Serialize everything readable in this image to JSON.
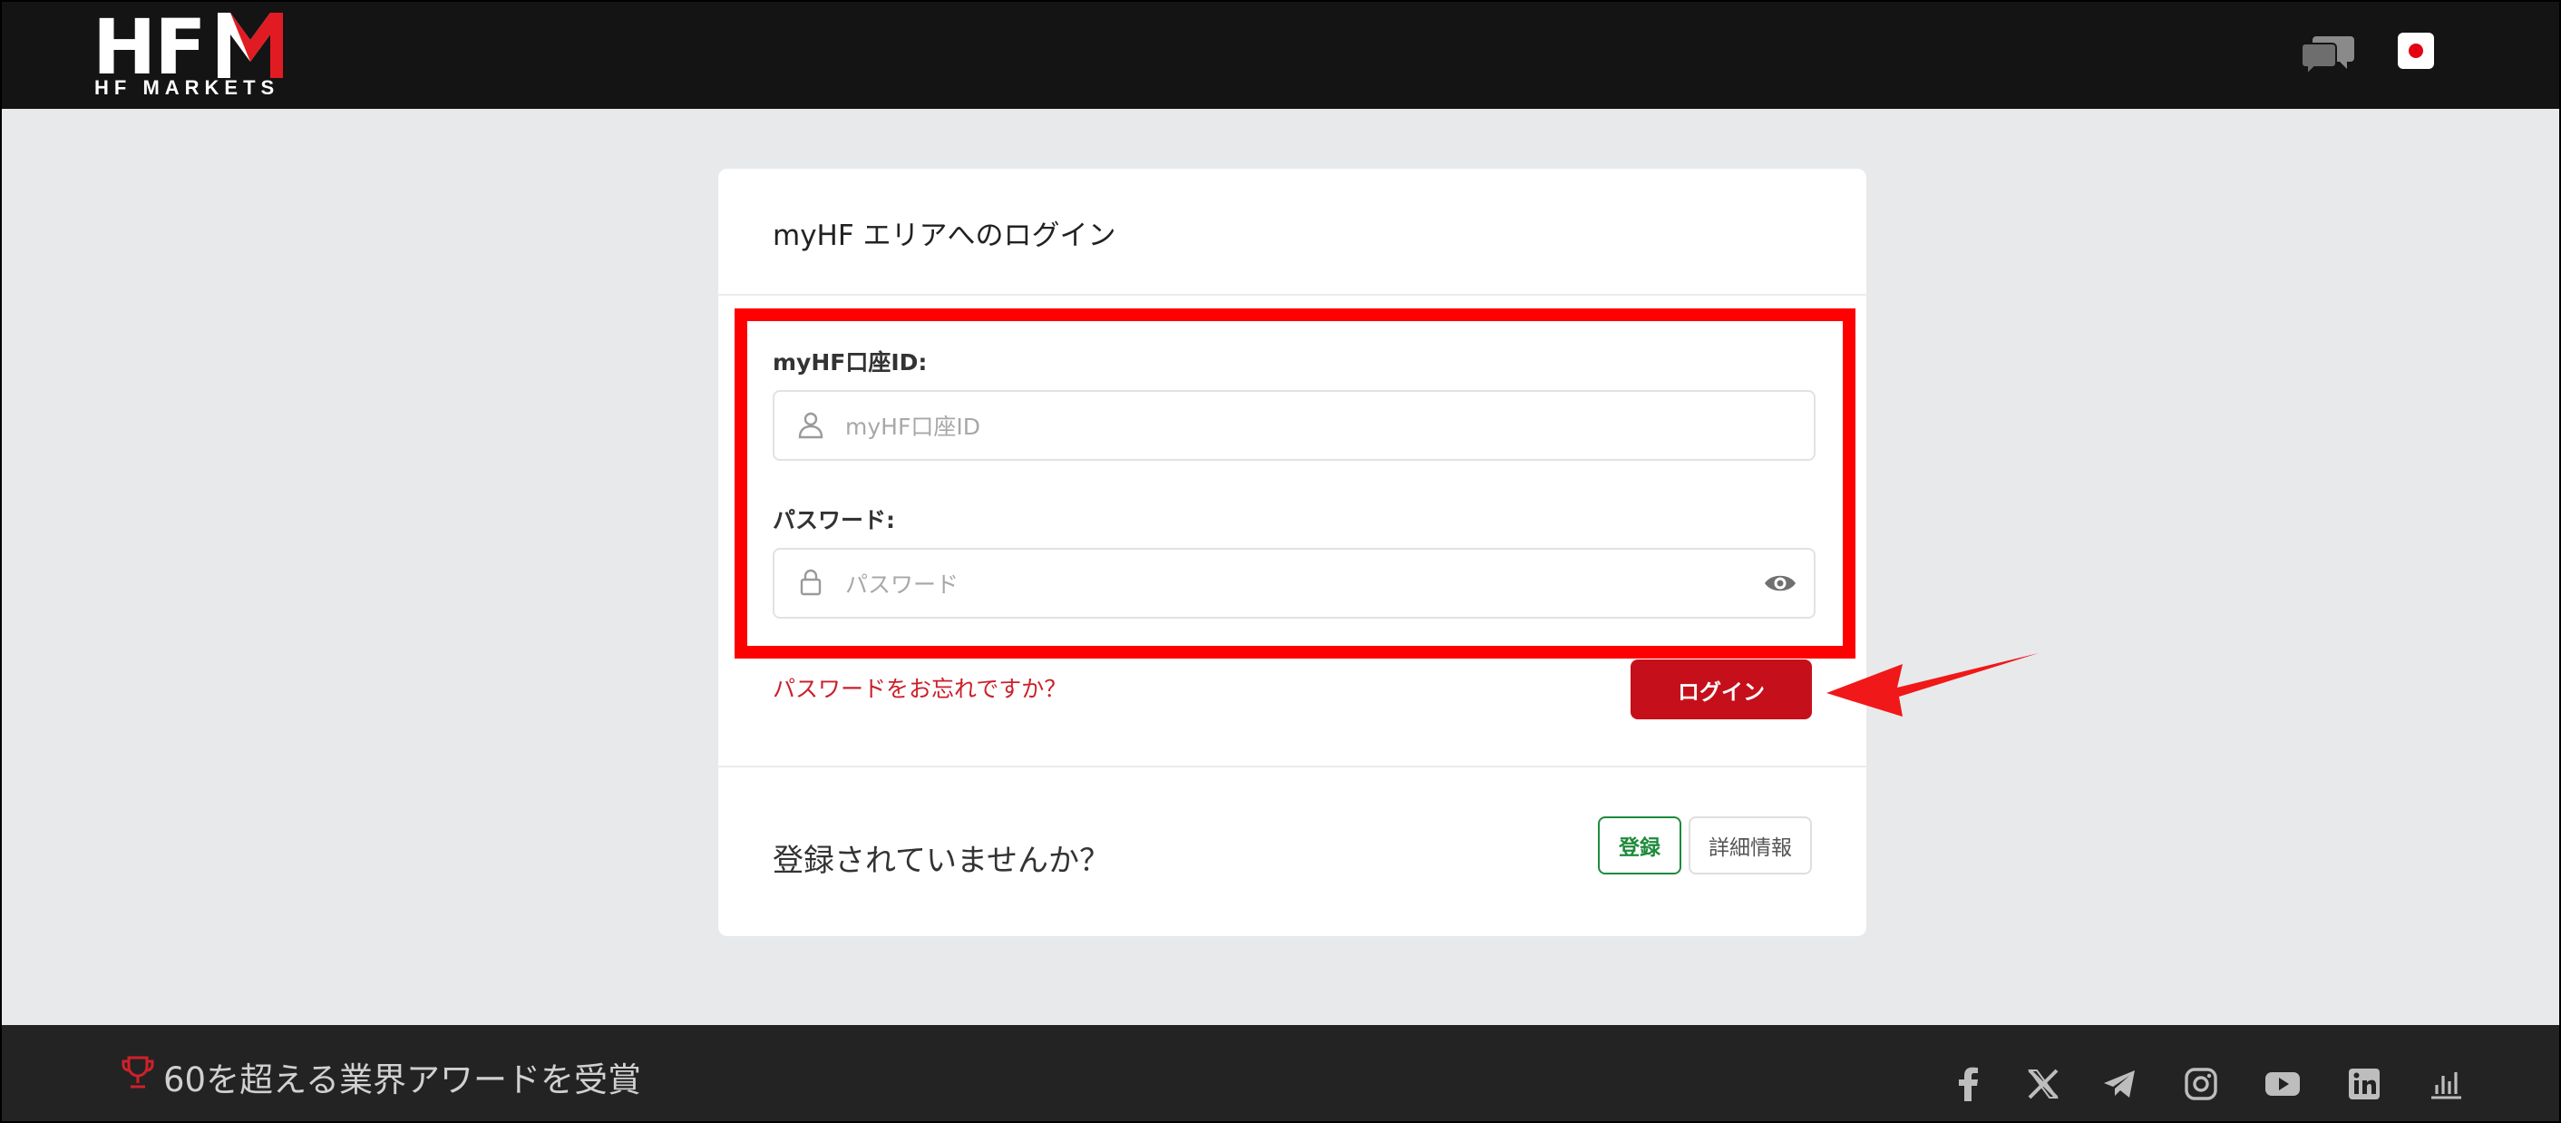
{
  "header": {
    "logo_text": "HF",
    "logo_sub": "HF MARKETS",
    "chat_icon": "chat-bubbles-icon",
    "language_icon": "japan-flag-icon"
  },
  "login": {
    "title": "myHF エリアへのログイン",
    "account_id_label": "myHF口座ID:",
    "account_id_placeholder": "myHF口座ID",
    "password_label": "パスワード:",
    "password_placeholder": "パスワード",
    "forgot_password": "パスワードをお忘れですか？",
    "login_button": "ログイン"
  },
  "register": {
    "question": "登録されていませんか？",
    "register_button": "登録",
    "info_button": "詳細情報"
  },
  "footer": {
    "award_text": "60を超える業界アワードを受賞",
    "social_icons": [
      "facebook-icon",
      "x-icon",
      "telegram-icon",
      "instagram-icon",
      "youtube-icon",
      "linkedin-icon",
      "chart-icon"
    ]
  },
  "colors": {
    "brand_red": "#c5101b",
    "highlight_red": "#ff0000",
    "register_green": "#1e8a3c"
  }
}
